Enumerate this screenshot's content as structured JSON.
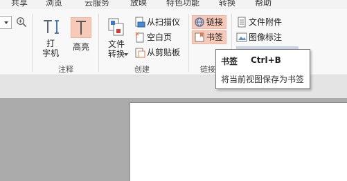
{
  "tabs": [
    "共享",
    "浏览",
    "云服务",
    "放映",
    "特色功能",
    "转换",
    "帮助"
  ],
  "typewriter": {
    "label_line1": "打",
    "label_line2": "字机"
  },
  "highlight_tool": {
    "label": "高亮"
  },
  "annotate_group": {
    "label": "注释"
  },
  "file_convert": {
    "label_line1": "文件",
    "label_line2": "转换"
  },
  "create_items": [
    "从扫描仪",
    "空白页",
    "从剪贴板"
  ],
  "create_group": {
    "label": "创建"
  },
  "link_items": [
    "链接",
    "书签"
  ],
  "link_group": {
    "label": "链接"
  },
  "insert_items": [
    "文件附件",
    "图像标注"
  ],
  "tooltip": {
    "title": "书签",
    "shortcut": "Ctrl+B",
    "description": "将当前视图保存为书签"
  },
  "colors": {
    "accent": "#e8784a",
    "highlight_button": "#f6c9b8",
    "ribbon_bg": "#f8f8f8",
    "workspace_bg": "#ababab"
  },
  "icons": {
    "zoom": "zoom-in-icon",
    "typewriter": "typewriter-icon",
    "highlight": "highlight-text-icon",
    "file_convert": "file-convert-icon",
    "scanner": "scanner-icon",
    "blank_page": "blank-page-icon",
    "clipboard": "clipboard-icon",
    "link": "link-globe-icon",
    "bookmark": "bookmark-icon",
    "attachment": "file-attachment-icon",
    "image_annotation": "image-annotation-icon"
  }
}
